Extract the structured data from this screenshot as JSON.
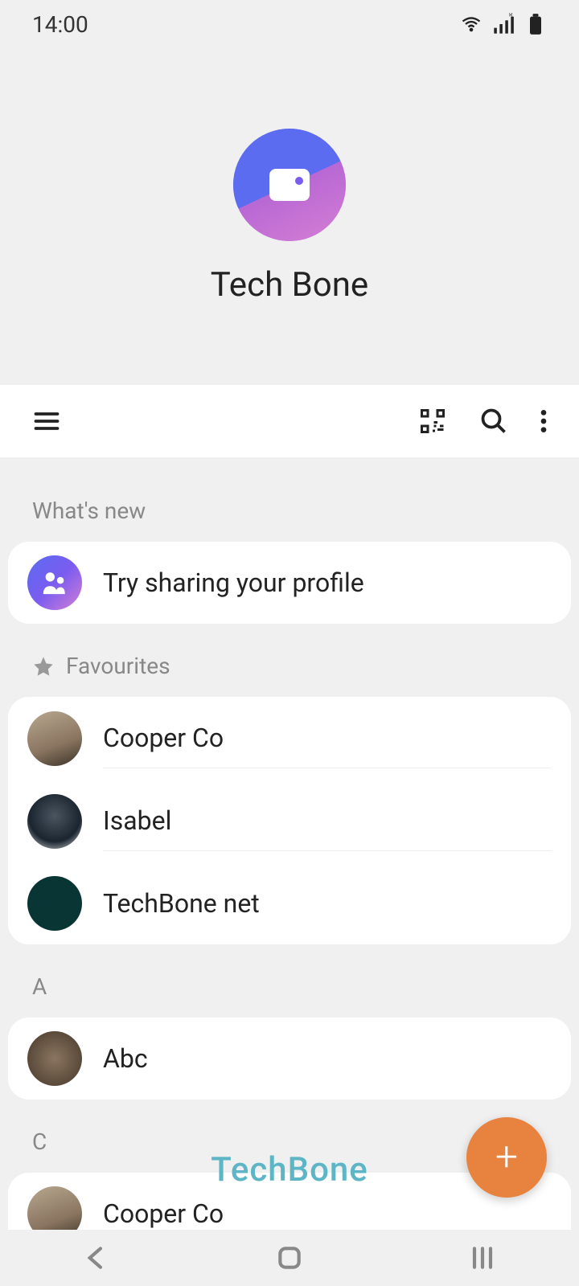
{
  "status_bar": {
    "time": "14:00"
  },
  "profile": {
    "name": "Tech Bone"
  },
  "sections": {
    "whats_new": {
      "label": "What's new",
      "items": [
        {
          "label": "Try sharing your profile"
        }
      ]
    },
    "favourites": {
      "label": "Favourites",
      "items": [
        {
          "name": "Cooper Co"
        },
        {
          "name": "Isabel"
        },
        {
          "name": "TechBone net"
        }
      ]
    },
    "a": {
      "label": "A",
      "items": [
        {
          "name": "Abc"
        }
      ]
    },
    "c": {
      "label": "C",
      "items": [
        {
          "name": "Cooper Co"
        }
      ]
    }
  },
  "watermark": "TechBone"
}
